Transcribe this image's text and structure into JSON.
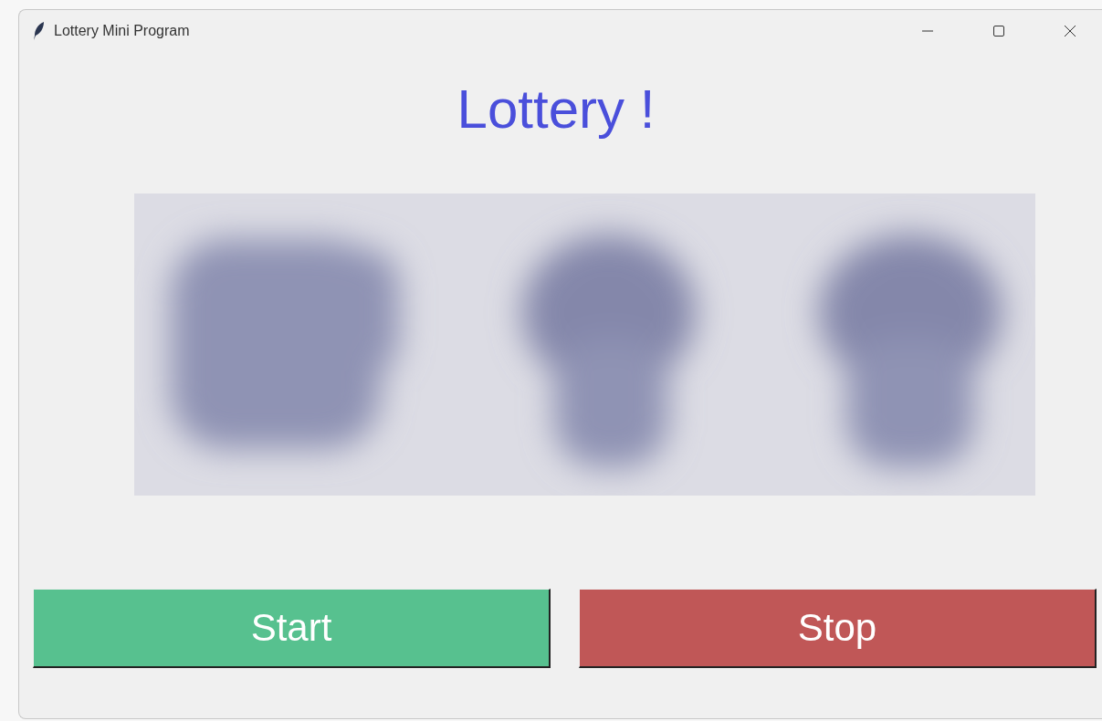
{
  "window": {
    "title": "Lottery Mini Program"
  },
  "heading": "Lottery !",
  "buttons": [
    {
      "label": "Start",
      "color": "#57c18f"
    },
    {
      "label": "Stop",
      "color": "#c05757"
    }
  ]
}
